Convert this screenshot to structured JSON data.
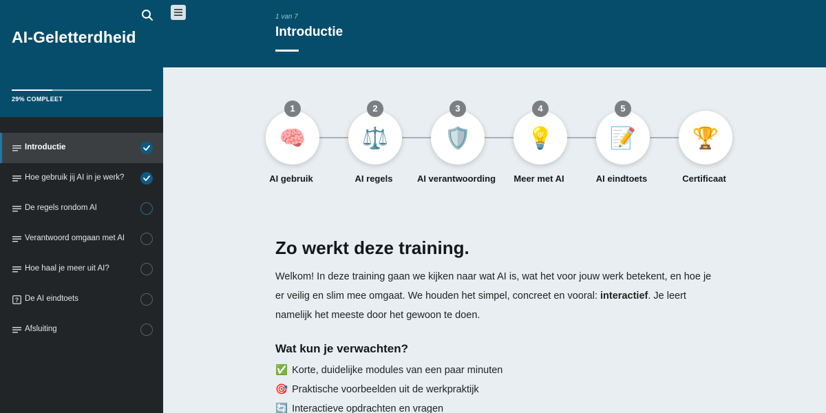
{
  "sidebar": {
    "course_title": "AI-Geletterdheid",
    "progress": {
      "percent": 29,
      "label": "29% COMPLEET"
    },
    "items": [
      {
        "label": "Introductie",
        "icon": "lines-icon",
        "status": "done",
        "active": true
      },
      {
        "label": "Hoe gebruik jij AI in je werk?",
        "icon": "lines-icon",
        "status": "done",
        "active": false
      },
      {
        "label": "De regels rondom AI",
        "icon": "lines-icon",
        "status": "todo-next",
        "active": false
      },
      {
        "label": "Verantwoord omgaan met AI",
        "icon": "lines-icon",
        "status": "todo",
        "active": false
      },
      {
        "label": "Hoe haal je meer uit AI?",
        "icon": "lines-icon",
        "status": "todo",
        "active": false
      },
      {
        "label": "De AI eindtoets",
        "icon": "quiz-icon",
        "status": "todo",
        "active": false
      },
      {
        "label": "Afsluiting",
        "icon": "lines-icon",
        "status": "todo",
        "active": false
      }
    ]
  },
  "header": {
    "lesson_count": "1 van 7",
    "lesson_title": "Introductie"
  },
  "steps": [
    {
      "num": "1",
      "emoji": "🧠",
      "label": "AI gebruik"
    },
    {
      "num": "2",
      "emoji": "⚖️",
      "label": "AI regels"
    },
    {
      "num": "3",
      "emoji": "🛡️",
      "label": "AI verantwoording"
    },
    {
      "num": "4",
      "emoji": "💡",
      "label": "Meer met AI"
    },
    {
      "num": "5",
      "emoji": "📝",
      "label": "AI eindtoets"
    },
    {
      "num": "",
      "emoji": "🏆",
      "label": "Certificaat"
    }
  ],
  "content": {
    "heading": "Zo werkt deze training.",
    "intro_before": "Welkom! In deze training gaan we kijken naar wat AI is, wat het voor jouw werk betekent, en hoe je er veilig en slim mee omgaat. We houden het simpel, concreet en vooral: ",
    "intro_bold": "interactief",
    "intro_after": ". Je leert namelijk het meeste door het gewoon te doen.",
    "subheading": "Wat kun je verwachten?",
    "bullets": [
      {
        "emoji": "✅",
        "text": "Korte, duidelijke modules van een paar minuten"
      },
      {
        "emoji": "🎯",
        "text": "Praktische voorbeelden uit de werkpraktijk"
      },
      {
        "emoji": "🔄",
        "text": "Interactieve opdrachten en vragen"
      }
    ]
  },
  "colors": {
    "header_bg": "#064d6b",
    "sidebar_bg": "#222527",
    "page_bg": "#e8eef2",
    "accent": "#0f5a85"
  }
}
